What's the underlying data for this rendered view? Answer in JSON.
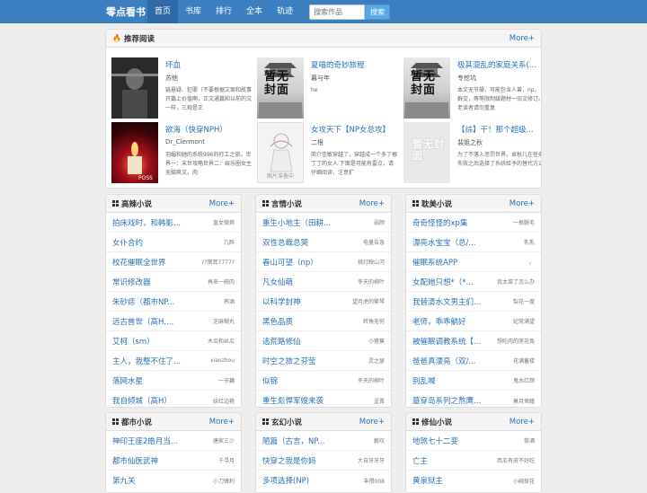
{
  "nav": {
    "brand": "零点看书",
    "items": [
      "首页",
      "书库",
      "排行",
      "全本",
      "轨迹"
    ],
    "search_placeholder": "搜索作品",
    "search_button": "搜索"
  },
  "recommend": {
    "title": "推荐阅读",
    "more": "More+",
    "books": [
      {
        "title": "坏血",
        "author": "苏他",
        "desc": "链悬疑、犯罪（不要根据文案和故事开篇上价值啊，正文通篇和以前的文一样，三观是正",
        "cover": "dark",
        "cover_text": ""
      },
      {
        "title": "夏喵的奇妙旅程",
        "author": "暮与年",
        "desc": "he",
        "cover": "pavilion",
        "cover_text": "暂无封面"
      },
      {
        "title": "极其混乱的家庭关系(...",
        "author": "专挖坑",
        "desc": "本文无节操，可能包含人兽，np，群交，等等限制级题材一旧文修订。老读者请勿重复",
        "cover": "pavilion",
        "cover_text": "暂无封面"
      },
      {
        "title": "欲海（快穿NPH）",
        "author": "Dr_Clermont",
        "desc": "羽媚和她的系统996的打工之旅。世界一：末世攻略世界二：娱乐圈女主无脑爽文。肉",
        "cover": "red",
        "cover_text": ""
      },
      {
        "title": "女攻天下【NP女总攻】",
        "author": "二根",
        "desc": "简介佳敏穿越了，穿越成一个多了根丁丁的女人 下面是可能有雷点，请仔细阅读，注意扩",
        "cover": "sketch",
        "cover_text": "",
        "cover_caption": "图片准备中"
      },
      {
        "title": "【综】干！那个超级...",
        "author": "裴姐之秋",
        "desc": "为了不落入惩罚世界，卓秋儿在任务失败之后选择了系统给予的替代方式",
        "cover": "nocover",
        "cover_text": "暂无封面"
      }
    ]
  },
  "lists": [
    {
      "title": "高辣小说",
      "more": "More+",
      "items": [
        {
          "title": "拍床戏时，和韩影...",
          "author": "直女微爽"
        },
        {
          "title": "女仆合约",
          "author": "几醉"
        },
        {
          "title": "校花催眠全世界",
          "author": "??狼耳7777?"
        },
        {
          "title": "常识修改器",
          "author": "再来一碗肉"
        },
        {
          "title": "朱砂痣（都市NP...",
          "author": "荞酒"
        },
        {
          "title": "远古兽世（高H,...",
          "author": "芝麻糊丸"
        },
        {
          "title": "艾柯（sm）",
          "author": "木瓜和丝瓜"
        },
        {
          "title": "主人，我整不住了...",
          "author": "xiaozhou"
        },
        {
          "title": "落网水星",
          "author": "一节藕"
        },
        {
          "title": "我自倾城（高H）",
          "author": "妖红边艳"
        }
      ]
    },
    {
      "title": "言情小说",
      "more": "More+",
      "items": [
        {
          "title": "重生小地主（田耕...",
          "author": "弱颜"
        },
        {
          "title": "双性总裁总哭",
          "author": "电量告急"
        },
        {
          "title": "春山可望（np）",
          "author": "挑灯映山河"
        },
        {
          "title": "凡女仙萌",
          "author": "冬天的柳叶"
        },
        {
          "title": "以科学封神",
          "author": "望月虎的繁琴"
        },
        {
          "title": "黑色品质",
          "author": "转角无何"
        },
        {
          "title": "逃荒路修仙",
          "author": "小猪蕉"
        },
        {
          "title": "时空之旅之芬莹",
          "author": "灵之瑟"
        },
        {
          "title": "似锦",
          "author": "冬天的柳叶"
        },
        {
          "title": "重生彪悍军嫂来袭",
          "author": "孟晋"
        }
      ]
    },
    {
      "title": "耽美小说",
      "more": "More+",
      "items": [
        {
          "title": "奇奇怪怪的xp集",
          "author": "一根腿毛"
        },
        {
          "title": "漂亮水宝宝（总/...",
          "author": "乳乳"
        },
        {
          "title": "催眠系统APP",
          "author": "。"
        },
        {
          "title": "女配她只想*（*...",
          "author": "我太菜了怎么办"
        },
        {
          "title": "我替清水文男主们...",
          "author": "梨花一度"
        },
        {
          "title": "老师，乖乖躺好",
          "author": "妃常满望"
        },
        {
          "title": "被催眠调教系统【...",
          "author": "想吃肉的莲花兔"
        },
        {
          "title": "爸爸真漂亮（双/...",
          "author": "花满蓄楼"
        },
        {
          "title": "别乱喊",
          "author": "鬼水红颜"
        },
        {
          "title": "墓穿岛系列之熬鹰...",
          "author": "莫月莺瞳"
        }
      ]
    },
    {
      "title": "都市小说",
      "more": "More+",
      "items": [
        {
          "title": "神印王座2皓月当...",
          "author": "唐家三少"
        },
        {
          "title": "都市仙医武神",
          "author": "千寻月"
        },
        {
          "title": "第九关",
          "author": "小刀锋利"
        }
      ]
    },
    {
      "title": "玄幻小说",
      "more": "More+",
      "items": [
        {
          "title": "陋篇（古言，NP...",
          "author": "薮叹"
        },
        {
          "title": "快穿之我是你妈",
          "author": "大自牙牙牙"
        },
        {
          "title": "多项选择(NP)",
          "author": "丰偎008"
        }
      ]
    },
    {
      "title": "修仙小说",
      "more": "More+",
      "items": [
        {
          "title": "地煞七十二变",
          "author": "祭酒"
        },
        {
          "title": "亡主",
          "author": "西瓜有皮不好吃"
        },
        {
          "title": "黄泉狱主",
          "author": "小碗探花"
        }
      ]
    }
  ],
  "colors": {
    "nav_bg": "#3c7fc1",
    "link": "#2a6fb5",
    "page_bg": "#eeeeee"
  }
}
